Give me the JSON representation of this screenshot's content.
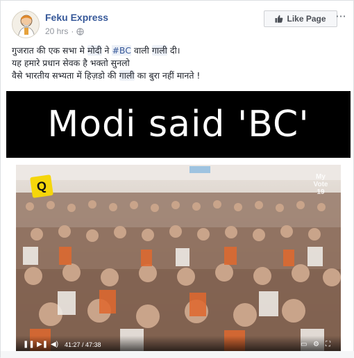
{
  "post": {
    "page_name": "Feku Express",
    "time": "20 hrs",
    "like_button": "Like Page",
    "more": "···",
    "text": {
      "l1_a": "गुजरात की एक सभा मे ",
      "l1_b": "मोदी",
      "l1_c": " ने ",
      "l1_d": "#BC",
      "l1_e": " वाली ",
      "l1_f": "गाली",
      "l1_g": " दी।",
      "l2": "यह हमारे प्रधान सेवक है भक्तो सुनलो",
      "l3_a": "वैसे भारतीय सभ्यता में हिज़डो की ",
      "l3_b": "गाली",
      "l3_c": " का बुरा नहीं मानते !"
    }
  },
  "media": {
    "title": "Modi said 'BC'",
    "logo_q": "Q",
    "logo_vote": "My Vote 19",
    "time_readout": "41:27 / 47:38"
  },
  "icons": {
    "avatar": "cartoon-avatar-icon",
    "globe": "globe-icon",
    "like": "thumbs-up-icon"
  },
  "colors": {
    "link": "#365899",
    "meta": "#90949c",
    "title_band": "#000000"
  }
}
